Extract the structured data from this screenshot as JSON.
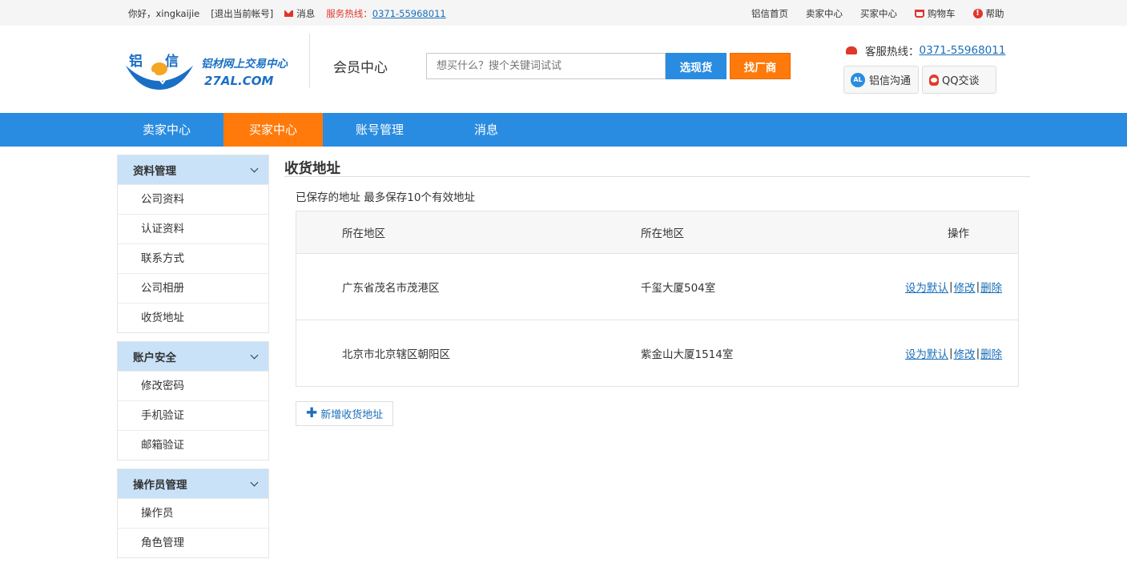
{
  "topbar": {
    "greeting": "你好，xingkaijie",
    "logout": "[退出当前帐号]",
    "messages": "消息",
    "hotline_label": "服务热线：",
    "hotline_number": "0371-55968011",
    "links": [
      "铝信首页",
      "卖家中心",
      "买家中心"
    ],
    "cart": "购物车",
    "help": "帮助"
  },
  "logo": {
    "chars": "铝信",
    "slogan": "铝材网上交易中心",
    "domain": "27AL.COM"
  },
  "header": {
    "page_heading": "会员中心",
    "search_placeholder": "想买什么？搜个关键词试试",
    "btn_spot": "选现货",
    "btn_factory": "找厂商",
    "service_label": "客服热线：",
    "service_number": "0371-55968011",
    "chat_al": "铝信沟通",
    "chat_al_badge": "AL",
    "chat_qq": "QQ交谈"
  },
  "nav": {
    "items": [
      "卖家中心",
      "买家中心",
      "账号管理",
      "消息"
    ],
    "active": "买家中心"
  },
  "sidebar": {
    "groups": [
      {
        "title": "资料管理",
        "items": [
          "公司资料",
          "认证资料",
          "联系方式",
          "公司相册",
          "收货地址"
        ]
      },
      {
        "title": "账户安全",
        "items": [
          "修改密码",
          "手机验证",
          "邮箱验证"
        ]
      },
      {
        "title": "操作员管理",
        "items": [
          "操作员",
          "角色管理"
        ]
      }
    ]
  },
  "main": {
    "title": "收货地址",
    "note": "已保存的地址 最多保存10个有效地址",
    "columns": [
      "所在地区",
      "所在地区",
      "操作"
    ],
    "rows": [
      {
        "region": "广东省茂名市茂港区",
        "address": "千玺大厦504室"
      },
      {
        "region": "北京市北京辖区朝阳区",
        "address": "紫金山大厦1514室"
      }
    ],
    "ops": {
      "set_default": "设为默认",
      "edit": "修改",
      "delete": "删除",
      "sep": "|"
    },
    "add_button": "新增收货地址"
  },
  "colors": {
    "brand_blue": "#2a8ce0",
    "accent_orange": "#ff7a0a",
    "sidebar_head": "#c9e2f8",
    "link": "#1a6fb8",
    "alert_red": "#e0362c"
  }
}
